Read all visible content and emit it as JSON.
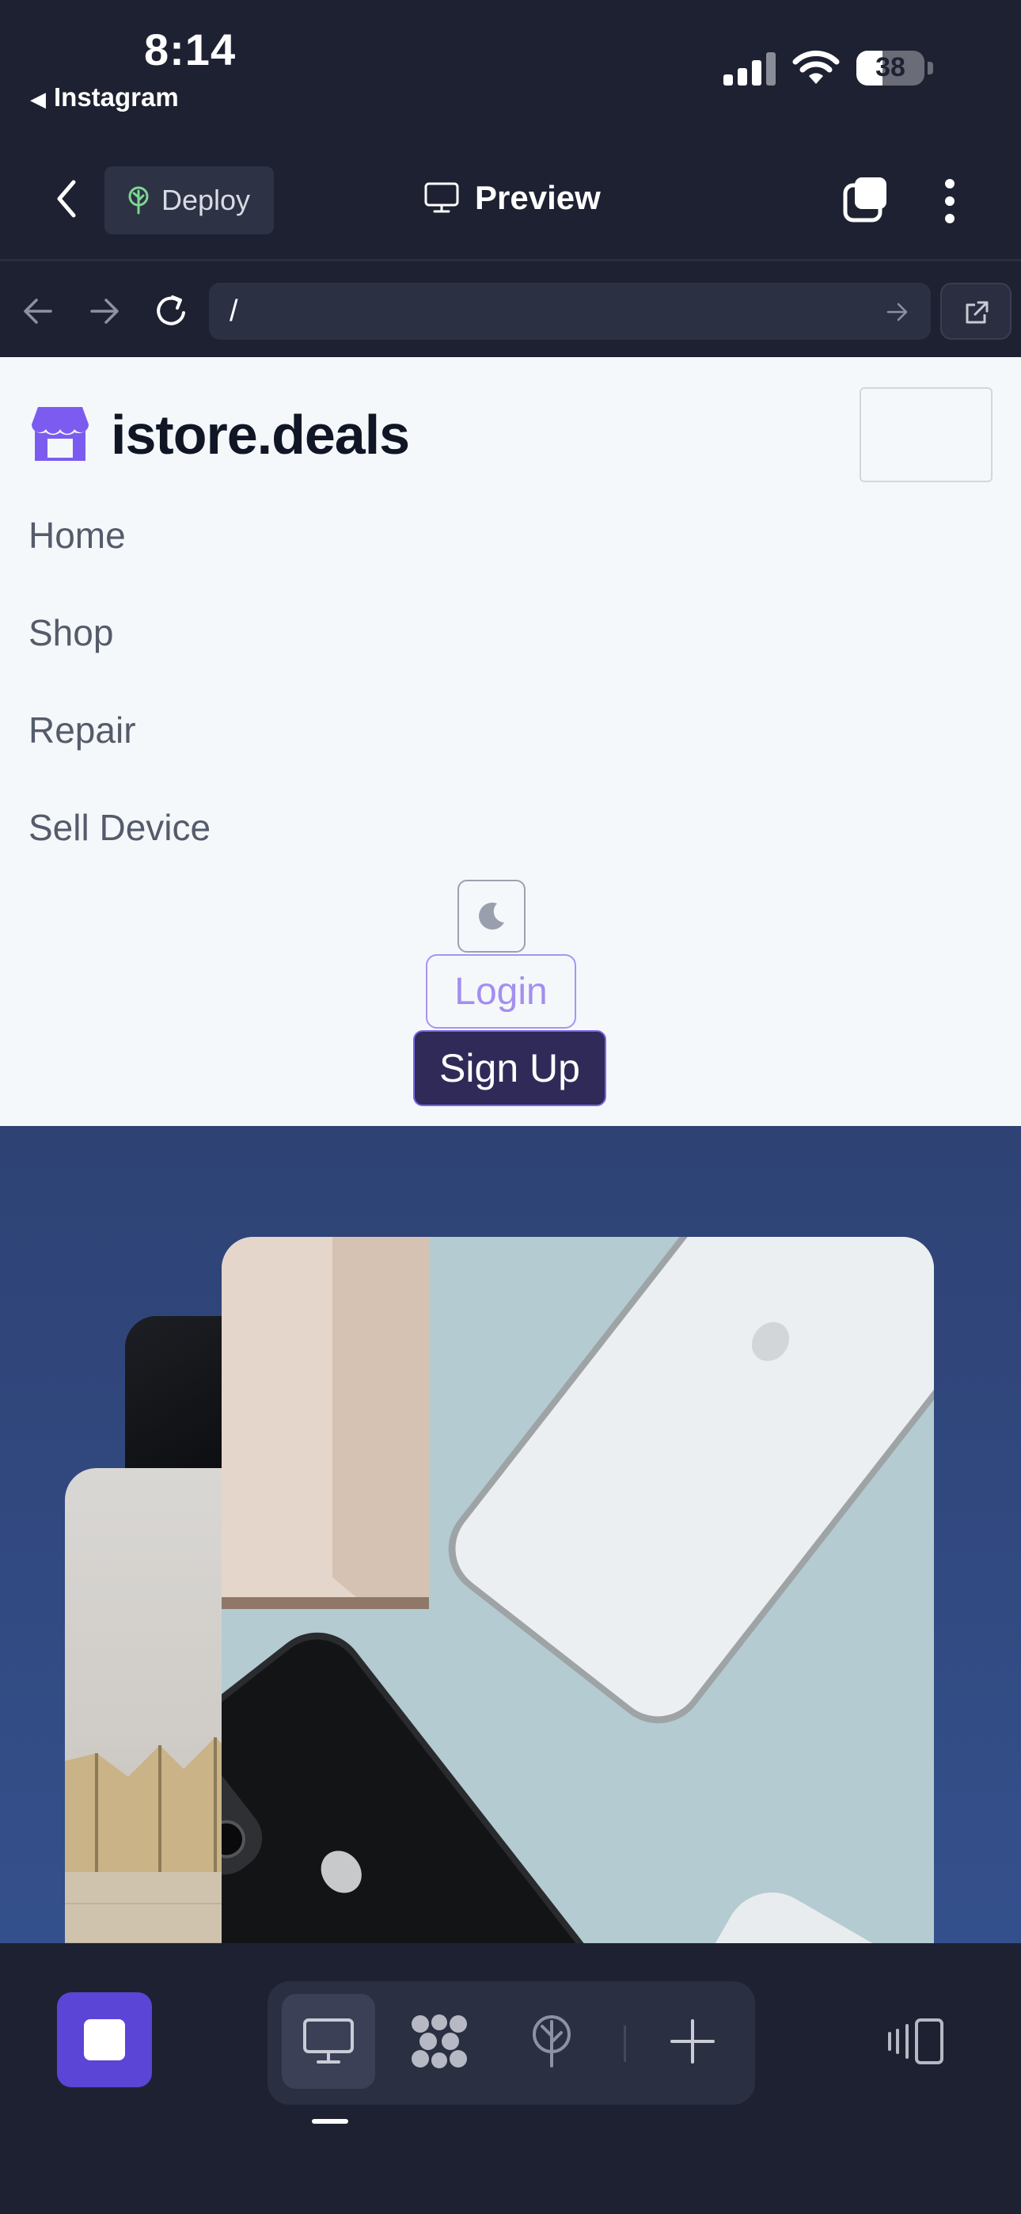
{
  "status_bar": {
    "time": "8:14",
    "back_app": "Instagram",
    "battery": "38",
    "battery_level": 0.38
  },
  "toolbar": {
    "deploy_label": "Deploy",
    "preview_label": "Preview"
  },
  "url_bar": {
    "path": "/"
  },
  "site": {
    "brand": "istore.deals",
    "nav": [
      "Home",
      "Shop",
      "Repair",
      "Sell Device"
    ],
    "login_label": "Login",
    "signup_label": "Sign Up"
  },
  "colors": {
    "accent": "#5a45d6",
    "brand_icon": "#7c5cf0",
    "deploy_icon": "#7bd88f",
    "hero_bg": "#2e4274"
  },
  "icons": {
    "toolbar": [
      "back-chevron-icon",
      "deploy-tree-icon",
      "monitor-icon",
      "tabs-icon",
      "more-vertical-icon"
    ],
    "url_bar": [
      "arrow-left-icon",
      "arrow-right-icon",
      "reload-icon",
      "go-arrow-icon",
      "external-link-icon"
    ],
    "bottom_bar": [
      "stop-icon",
      "desktop-icon",
      "apps-icon",
      "deploy-icon",
      "plus-icon",
      "device-rotate-icon"
    ]
  }
}
